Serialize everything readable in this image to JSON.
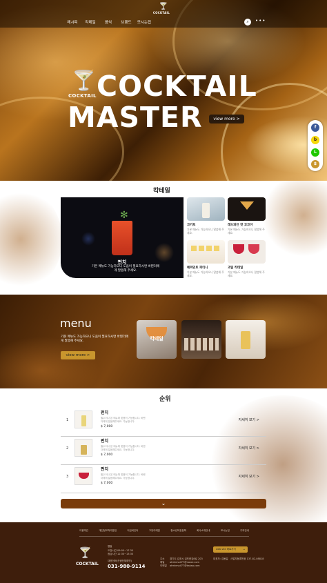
{
  "header": {
    "logo_text": "COCKTAIL",
    "nav": [
      "레시피",
      "칵테일",
      "음식",
      "브랜드",
      "모시는집"
    ],
    "more": "•••"
  },
  "hero": {
    "icon_label": "COCKTAIL",
    "title_line1": "COCKTAIL",
    "title_line2": "MASTER",
    "button": "view more  >"
  },
  "social": [
    "f",
    "b",
    "L",
    "$"
  ],
  "category": {
    "title": "칵테일",
    "featured": {
      "name": "펀치",
      "desc": "기본 메뉴도 가능하오니 도움이 필요하시면 바텐더에게 말씀해 주세요."
    },
    "cards": [
      {
        "name": "코키토",
        "desc": "기본 메뉴도 가능하오니 말씀해 주세요."
      },
      {
        "name": "레드와인 핫 코코아",
        "desc": "기본 메뉴도 가능하오니 말씀해 주세요."
      },
      {
        "name": "페퍼민트 파티니",
        "desc": "기본 메뉴도 가능하오니 말씀해 주세요."
      },
      {
        "name": "과일 칵테일",
        "desc": "기본 메뉴도 가능하오니 말씀해 주세요."
      }
    ]
  },
  "menu": {
    "title": "menu",
    "desc": "기본 메뉴도 가능하오니 도움이 필요하시면 바텐더에게 말씀해 주세요.",
    "button": "view more  >",
    "images": [
      {
        "caption": "칵테일"
      },
      {
        "caption": ""
      },
      {
        "caption": ""
      }
    ]
  },
  "ranking": {
    "title": "순위",
    "rows": [
      {
        "no": "1",
        "name": "펀치",
        "desc": "필수이나 본 메뉴에 맞춤이 가능합니다. 바텐더에게 말씀해주세요. 가능합니다.",
        "price": "$ 7,000",
        "detail": "자세히 보기  >"
      },
      {
        "no": "2",
        "name": "펀치",
        "desc": "필수이나 본 메뉴에 맞춤이 가능합니다. 바텐더에게 말씀해주세요. 가능합니다.",
        "price": "$ 7,000",
        "detail": "자세히 보기  >"
      },
      {
        "no": "3",
        "name": "펀치",
        "desc": "필수이나 본 메뉴에 맞춤이 가능합니다. 바텐더에게 말씀해주세요. 가능합니다.",
        "price": "$ 7,000",
        "detail": "자세히 보기  >"
      }
    ],
    "more": "⌄"
  },
  "footer": {
    "links": [
      "이용약관",
      "개인정보처리방침",
      "이금비인터",
      "고유이메일",
      "청소년보호정책",
      "회사소개안내",
      "모시는집",
      "주의안내"
    ],
    "logo_text": "COCKTAIL",
    "hours_label": "평일",
    "hours1": "오전시간 09:00~17:30",
    "hours2": "점심시간 12:30~13:30",
    "center": "대표전화(관광단체예약)",
    "phone": "031-980-9114",
    "addr_labels": [
      "주소",
      "메일",
      "이메일"
    ],
    "addr_vals": [
      "경기도 김포시 김포한강8로 203",
      "atmhmail77@naver.com",
      "atmhmail77@kakao.com"
    ],
    "right_info": [
      "대표자: 김동일",
      "사업자등록번호 137-82-08818"
    ],
    "select": "web site 바로가기"
  }
}
